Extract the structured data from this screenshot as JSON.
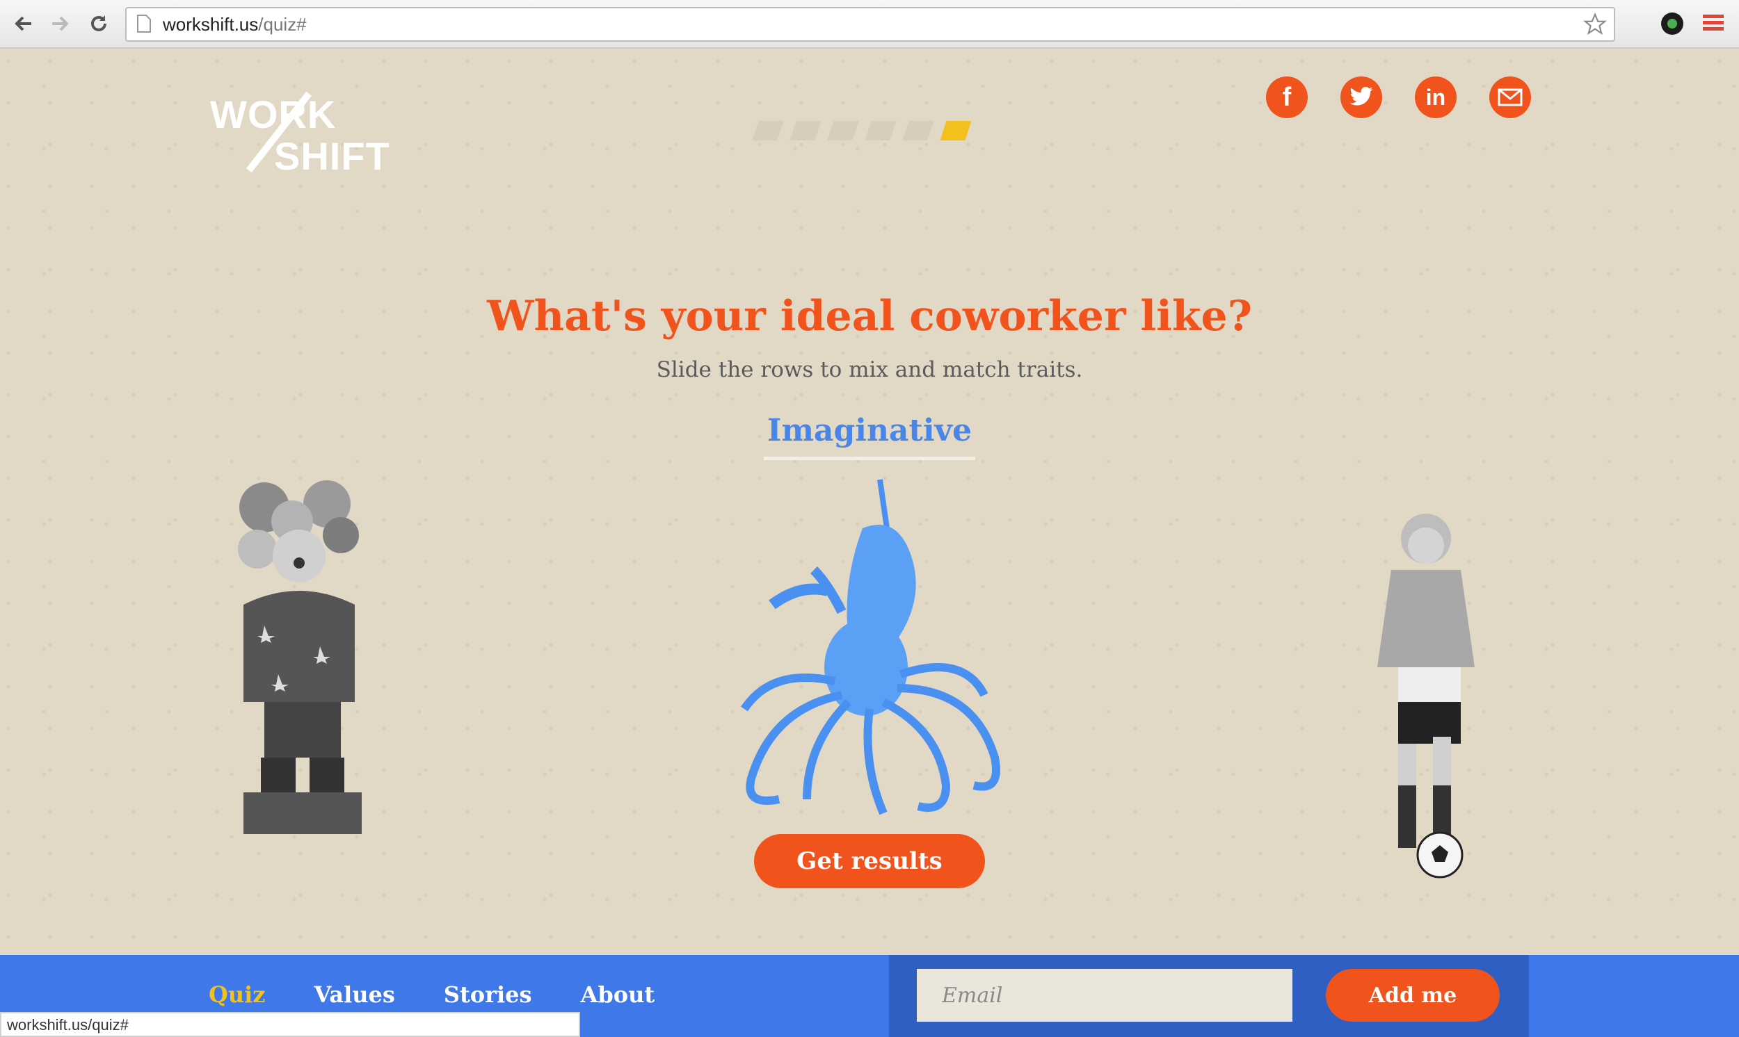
{
  "browser": {
    "url_host": "workshift.us",
    "url_path": "/quiz#",
    "status_url": "workshift.us/quiz#"
  },
  "header": {
    "logo_line1": "WORK",
    "logo_line2": "SHIFT",
    "progress": {
      "total_steps": 6,
      "current_step": 6
    },
    "socials": [
      {
        "name": "facebook-icon",
        "glyph": "f"
      },
      {
        "name": "twitter-icon",
        "glyph": ""
      },
      {
        "name": "linkedin-icon",
        "glyph": "in"
      },
      {
        "name": "email-icon",
        "glyph": ""
      }
    ]
  },
  "main": {
    "headline": "What's your ideal coworker like?",
    "subhead": "Slide the rows to mix and match traits.",
    "trait_label": "Imaginative",
    "cta_label": "Get results"
  },
  "footer": {
    "nav": [
      "Quiz",
      "Values",
      "Stories",
      "About"
    ],
    "active_nav": "Quiz",
    "email_placeholder": "Email",
    "add_button": "Add me"
  },
  "colors": {
    "accent": "#f0541c",
    "blue": "#4a86e8",
    "footer": "#3f78e8",
    "highlight": "#f3c01d",
    "background": "#e2d8c6"
  }
}
